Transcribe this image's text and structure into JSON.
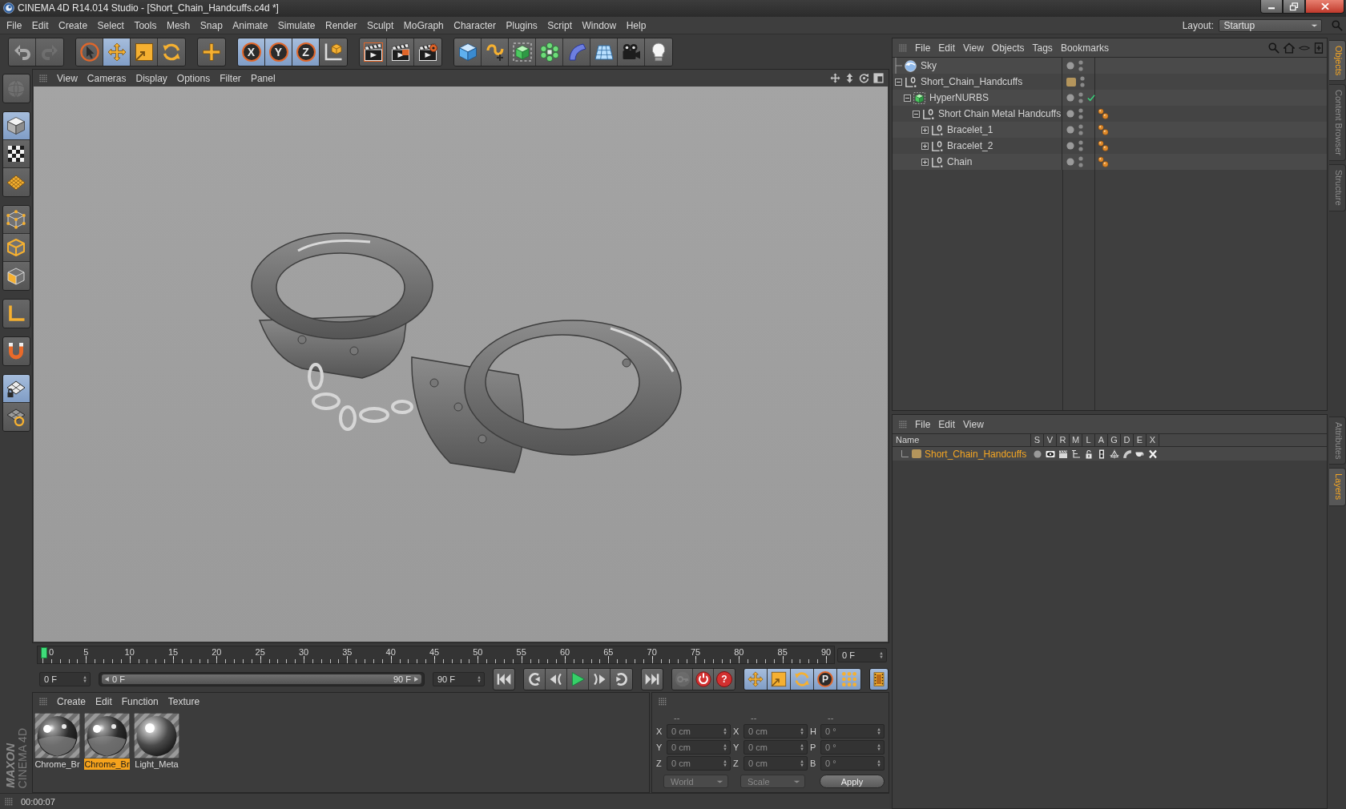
{
  "window": {
    "title": "CINEMA 4D R14.014 Studio - [Short_Chain_Handcuffs.c4d *]"
  },
  "menu_bar": {
    "items": [
      "File",
      "Edit",
      "Create",
      "Select",
      "Tools",
      "Mesh",
      "Snap",
      "Animate",
      "Simulate",
      "Render",
      "Sculpt",
      "MoGraph",
      "Character",
      "Plugins",
      "Script",
      "Window",
      "Help"
    ],
    "layout_label": "Layout:",
    "layout_value": "Startup"
  },
  "toolbar": {
    "groups": [
      {
        "tools": [
          {
            "kind": "undo",
            "selected": false,
            "disabled": false
          },
          {
            "kind": "redo",
            "selected": false,
            "disabled": true
          }
        ]
      },
      {
        "tools": [
          {
            "kind": "select",
            "selected": false,
            "disabled": false
          },
          {
            "kind": "move",
            "selected": true,
            "disabled": false
          },
          {
            "kind": "scale",
            "selected": false,
            "disabled": false
          },
          {
            "kind": "rotate",
            "selected": false,
            "disabled": false
          }
        ]
      },
      {
        "tools": [
          {
            "kind": "recent",
            "selected": false,
            "disabled": false
          }
        ]
      },
      {
        "tools": [
          {
            "kind": "axis",
            "label": "X",
            "selected": true,
            "disabled": false
          },
          {
            "kind": "axis",
            "label": "Y",
            "selected": true,
            "disabled": false
          },
          {
            "kind": "axis",
            "label": "Z",
            "selected": true,
            "disabled": false
          },
          {
            "kind": "coords",
            "selected": false,
            "disabled": false
          }
        ]
      },
      {
        "tools": [
          {
            "kind": "renderview",
            "selected": false,
            "disabled": false
          },
          {
            "kind": "renderpicture",
            "selected": false,
            "disabled": false
          },
          {
            "kind": "rendersettings",
            "selected": false,
            "disabled": false
          }
        ]
      },
      {
        "tools": [
          {
            "kind": "cube",
            "selected": false,
            "disabled": false
          },
          {
            "kind": "spline",
            "selected": false,
            "disabled": false
          },
          {
            "kind": "nurbs",
            "selected": false,
            "disabled": false
          },
          {
            "kind": "array",
            "selected": false,
            "disabled": false
          },
          {
            "kind": "deformer",
            "selected": false,
            "disabled": false
          },
          {
            "kind": "floor",
            "selected": false,
            "disabled": false
          },
          {
            "kind": "camera",
            "selected": false,
            "disabled": false
          },
          {
            "kind": "light",
            "selected": false,
            "disabled": false
          }
        ]
      }
    ]
  },
  "left_tools": {
    "groups": [
      {
        "tools": [
          {
            "kind": "editable",
            "selected": false,
            "disabled": true
          }
        ]
      },
      {
        "tools": [
          {
            "kind": "model",
            "selected": true,
            "disabled": false
          },
          {
            "kind": "texture",
            "selected": false,
            "disabled": false
          },
          {
            "kind": "workplane",
            "selected": false,
            "disabled": false
          }
        ]
      },
      {
        "tools": [
          {
            "kind": "points",
            "selected": false,
            "disabled": false
          },
          {
            "kind": "edges",
            "selected": false,
            "disabled": false
          },
          {
            "kind": "polygons",
            "selected": false,
            "disabled": false
          }
        ]
      },
      {
        "tools": [
          {
            "kind": "axismode",
            "selected": false,
            "disabled": false
          }
        ]
      },
      {
        "tools": [
          {
            "kind": "magnet",
            "selected": false,
            "disabled": false
          }
        ]
      },
      {
        "tools": [
          {
            "kind": "grid",
            "selected": true,
            "disabled": false
          },
          {
            "kind": "gridlock",
            "selected": false,
            "disabled": false
          }
        ]
      }
    ]
  },
  "viewport": {
    "menu": [
      "View",
      "Cameras",
      "Display",
      "Options",
      "Filter",
      "Panel"
    ]
  },
  "timeline": {
    "labels": [
      "0",
      "5",
      "10",
      "15",
      "20",
      "25",
      "30",
      "35",
      "40",
      "45",
      "50",
      "55",
      "60",
      "65",
      "70",
      "75",
      "80",
      "85",
      "90"
    ],
    "level": 0,
    "frame": "0 F"
  },
  "transport": {
    "start": "0 F",
    "range": {
      "start": "0 F",
      "end": "90 F",
      "level": 1
    },
    "end": "90 F",
    "groups": [
      {
        "buttons": [
          {
            "kind": "first",
            "selected": false,
            "disabled": false
          }
        ]
      },
      {
        "buttons": [
          {
            "kind": "prevkey",
            "selected": false,
            "disabled": false
          },
          {
            "kind": "prevframe",
            "selected": false,
            "disabled": false
          },
          {
            "kind": "play",
            "selected": false,
            "disabled": false
          },
          {
            "kind": "nextframe",
            "selected": false,
            "disabled": false
          },
          {
            "kind": "nextkey",
            "selected": false,
            "disabled": false
          }
        ]
      },
      {
        "buttons": [
          {
            "kind": "last",
            "selected": false,
            "disabled": false
          }
        ]
      },
      {
        "buttons": [
          {
            "kind": "record",
            "selected": false,
            "disabled": true
          },
          {
            "kind": "autokey",
            "selected": false,
            "disabled": false
          },
          {
            "kind": "keysel",
            "label": "?",
            "selected": false,
            "disabled": false
          }
        ]
      },
      {
        "buttons": [
          {
            "kind": "pos",
            "selected": true,
            "disabled": false
          },
          {
            "kind": "scalekey",
            "selected": true,
            "disabled": false
          },
          {
            "kind": "rotkey",
            "selected": true,
            "disabled": false
          },
          {
            "kind": "param",
            "label": "P",
            "selected": true,
            "disabled": false
          },
          {
            "kind": "pla",
            "selected": true,
            "disabled": false
          }
        ]
      },
      {
        "buttons": [
          {
            "kind": "timeline",
            "selected": true,
            "disabled": false
          }
        ]
      }
    ]
  },
  "materials": {
    "menu": [
      "Create",
      "Edit",
      "Function",
      "Texture"
    ],
    "items": [
      {
        "name": "Chrome_Br",
        "kind": "chrome",
        "selected": false
      },
      {
        "name": "Chrome_Br",
        "kind": "chrome",
        "selected": true
      },
      {
        "name": "Light_Meta",
        "kind": "metal",
        "selected": false
      }
    ]
  },
  "coordinates": {
    "headers": [
      "--",
      "--",
      "--"
    ],
    "rows": [
      {
        "cells": [
          {
            "label": "X",
            "value": "0 cm"
          },
          {
            "label": "X",
            "value": "0 cm"
          },
          {
            "label": "H",
            "value": "0 °"
          }
        ]
      },
      {
        "cells": [
          {
            "label": "Y",
            "value": "0 cm"
          },
          {
            "label": "Y",
            "value": "0 cm"
          },
          {
            "label": "P",
            "value": "0 °"
          }
        ]
      },
      {
        "cells": [
          {
            "label": "Z",
            "value": "0 cm"
          },
          {
            "label": "Z",
            "value": "0 cm"
          },
          {
            "label": "B",
            "value": "0 °"
          }
        ]
      }
    ],
    "mode": "World",
    "size_mode": "Scale",
    "apply": "Apply"
  },
  "logo": {
    "brand": "MAXON",
    "product": "CINEMA 4D"
  },
  "status_bar": {
    "time": "00:00:07"
  },
  "objects": {
    "menu": [
      "File",
      "Edit",
      "View",
      "Objects",
      "Tags",
      "Bookmarks"
    ],
    "tree": [
      {
        "name": "Sky",
        "kind": "sky",
        "in_layer": false
      },
      {
        "name": "Short_Chain_Handcuffs",
        "kind": "null",
        "in_layer": true,
        "expanded": true,
        "children": [
          {
            "name": "HyperNURBS",
            "kind": "hypernurbs",
            "in_layer": false,
            "expanded": true,
            "enabled": true,
            "children": [
              {
                "name": "Short Chain Metal Handcuffs",
                "kind": "null",
                "in_layer": false,
                "expanded": true,
                "tags": [
                  {
                    "kind": "material"
                  }
                ],
                "children": [
                  {
                    "name": "Bracelet_1",
                    "kind": "null",
                    "in_layer": false,
                    "expanded": false,
                    "tags": [
                      {
                        "kind": "material"
                      }
                    ]
                  },
                  {
                    "name": "Bracelet_2",
                    "kind": "null",
                    "in_layer": false,
                    "expanded": false,
                    "tags": [
                      {
                        "kind": "material"
                      }
                    ]
                  },
                  {
                    "name": "Chain",
                    "kind": "null",
                    "in_layer": false,
                    "expanded": false,
                    "tags": [
                      {
                        "kind": "material"
                      }
                    ]
                  }
                ]
              }
            ]
          }
        ]
      }
    ]
  },
  "side_tabs_top": [
    {
      "label": "Objects",
      "selected": true
    },
    {
      "label": "Content Browser",
      "selected": false
    },
    {
      "label": "Structure",
      "selected": false
    }
  ],
  "layers": {
    "menu": [
      "File",
      "Edit",
      "View"
    ],
    "columns": [
      "Name",
      "S",
      "V",
      "R",
      "M",
      "L",
      "A",
      "G",
      "D",
      "E",
      "X"
    ],
    "rows": [
      {
        "name": "Short_Chain_Handcuffs",
        "color": "#b4955c",
        "selected": true
      }
    ]
  },
  "side_tabs_bottom": [
    {
      "label": "Attributes",
      "selected": false
    },
    {
      "label": "Layers",
      "selected": true
    }
  ]
}
